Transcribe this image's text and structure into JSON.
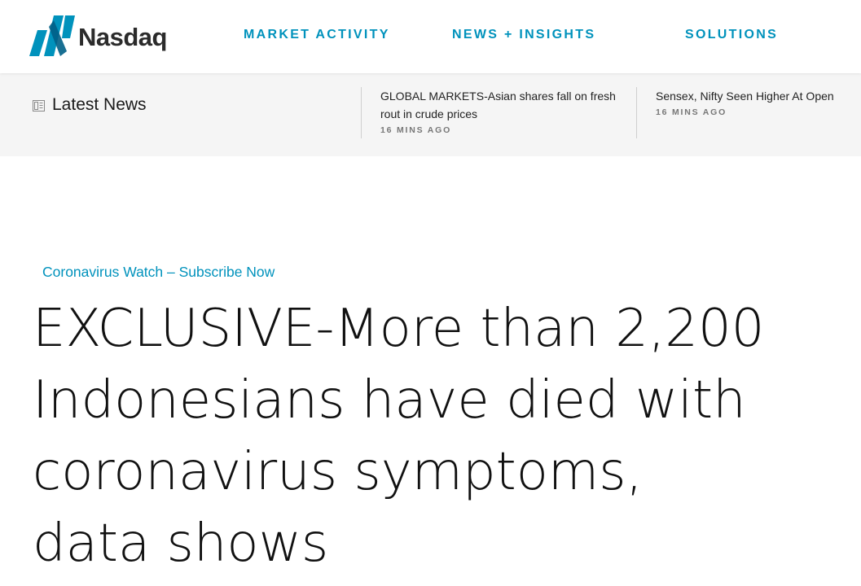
{
  "header": {
    "logo_text": "Nasdaq",
    "brand_color": "#0092bc",
    "nav": [
      {
        "label": "MARKET ACTIVITY"
      },
      {
        "label": "NEWS + INSIGHTS"
      },
      {
        "label": "SOLUTIONS"
      }
    ]
  },
  "latest_news": {
    "title": "Latest News",
    "icon": "newspaper-icon",
    "items": [
      {
        "headline": "GLOBAL MARKETS-Asian shares fall on fresh rout in crude prices",
        "time": "16 MINS AGO"
      },
      {
        "headline": "Sensex, Nifty Seen Higher At Open",
        "time": "16 MINS AGO"
      }
    ]
  },
  "article": {
    "kicker": "Coronavirus Watch – Subscribe Now",
    "headline": "EXCLUSIVE-More than 2,200 Indonesians have died with coronavirus symptoms, data shows"
  }
}
